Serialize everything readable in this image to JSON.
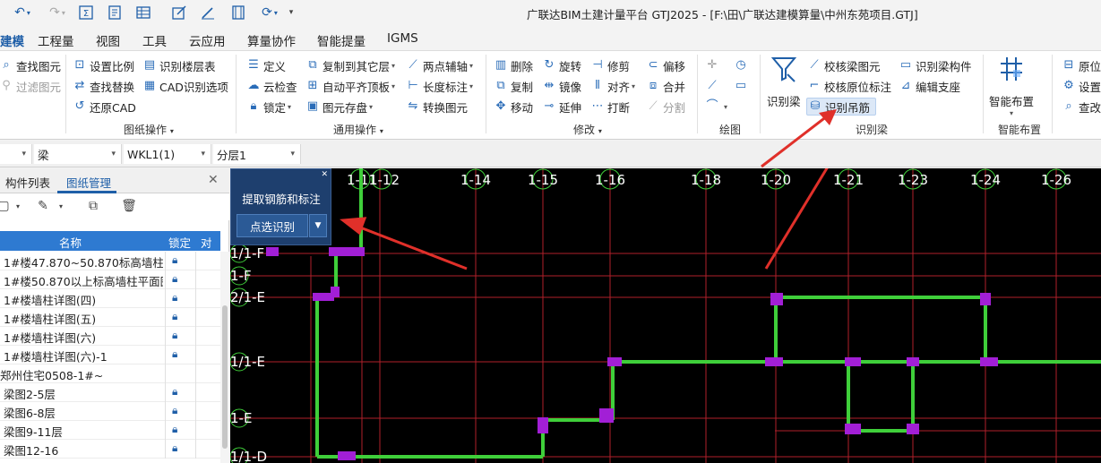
{
  "window": {
    "title": "广联达BIM土建计量平台 GTJ2025 - [F:\\田\\广联达建模算量\\中州东苑项目.GTJ]"
  },
  "quick_access": {
    "undo_icon": "undo-icon",
    "redo_icon": "redo-icon",
    "sum_icon": "sum-icon",
    "report_icon": "report-icon",
    "table_icon": "table-icon",
    "edit_icon": "edit-icon",
    "film_icon": "film-icon",
    "sync_icon": "sync-icon",
    "more_icon": "chevron-down-icon"
  },
  "menu": {
    "items": [
      "建模",
      "工程量",
      "视图",
      "工具",
      "云应用",
      "算量协作",
      "智能提量",
      "IGMS"
    ],
    "active": "建模"
  },
  "ribbon": {
    "col_left": [
      "查找图元",
      "过滤图元"
    ],
    "drawing_ops": {
      "items": [
        "设置比例",
        "查找替换",
        "还原CAD",
        "识别楼层表",
        "CAD识别选项"
      ],
      "label": "图纸操作"
    },
    "general_ops": {
      "items": [
        "定义",
        "云检查",
        "锁定",
        "复制到其它层",
        "自动平齐顶板",
        "图元存盘",
        "两点辅轴",
        "长度标注",
        "转换图元"
      ],
      "label": "通用操作"
    },
    "modify": {
      "items": [
        "删除",
        "旋转",
        "修剪",
        "偏移",
        "复制",
        "镜像",
        "对齐",
        "合并",
        "移动",
        "延伸",
        "打断",
        "分割"
      ],
      "label": "修改"
    },
    "draw": {
      "label": "绘图"
    },
    "identify_beam": {
      "big_button": "识别梁",
      "items": [
        "校核梁图元",
        "识别梁构件",
        "校核原位标注",
        "编辑支座",
        "识别吊筋"
      ],
      "label": "识别梁"
    },
    "smart_layout": {
      "big_button": "智能布置",
      "label": "智能布置"
    },
    "col_right": [
      "原位",
      "设置",
      "查改"
    ]
  },
  "filterbar": {
    "combo1": "",
    "combo2": "梁",
    "combo3": "WKL1(1)",
    "combo4": "分层1"
  },
  "panel": {
    "tabs": [
      "构件列表",
      "图纸管理"
    ],
    "active_tab": "图纸管理",
    "columns": [
      "名称",
      "锁定",
      "对"
    ],
    "rows": [
      "1#楼47.870~50.870标高墙柱...",
      "1#楼50.870以上标高墙柱平面图",
      "1#楼墙柱详图(四)",
      "1#楼墙柱详图(五)",
      "1#楼墙柱详图(六)",
      "1#楼墙柱详图(六)-1",
      "郑州住宅0508-1#~",
      "梁图2-5层",
      "梁图6-8层",
      "梁图9-11层",
      "梁图12-16"
    ]
  },
  "float_dialog": {
    "btn_extract": "提取钢筋和标注",
    "btn_pick": "点选识别"
  },
  "canvas": {
    "axis_top": [
      "1-11",
      "1-12",
      "1-14",
      "1-15",
      "1-16",
      "1-18",
      "1-20",
      "1-21",
      "1-23",
      "1-24",
      "1-26"
    ],
    "axis_left": [
      "1/1-F",
      "1-F",
      "2/1-E",
      "1/1-E",
      "1-E",
      "1/1-D"
    ],
    "colors": {
      "background": "#000000",
      "grid": "#b0202a",
      "beam": "#3fcf3a",
      "column": "#a21fd6",
      "arrow": "#e0302a"
    }
  }
}
